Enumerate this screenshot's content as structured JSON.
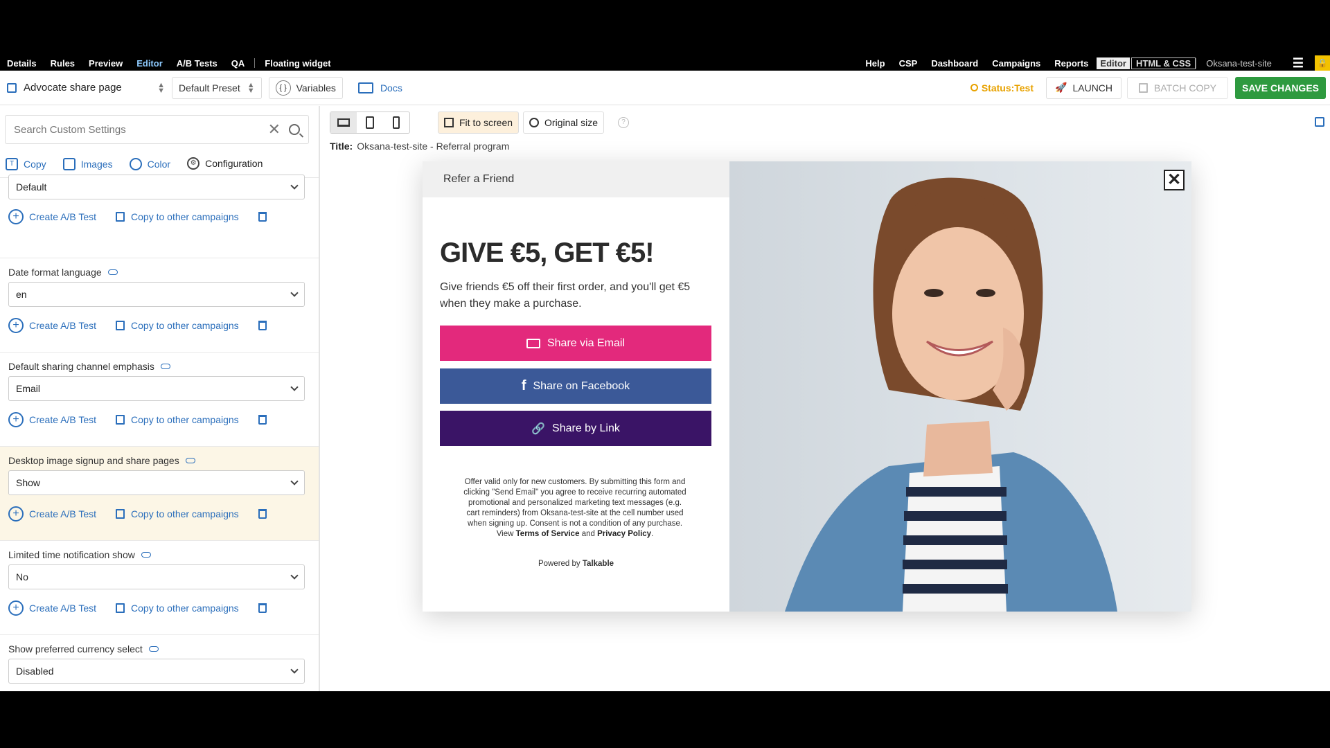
{
  "topnav": {
    "left": [
      "Details",
      "Rules",
      "Preview",
      "Editor",
      "A/B Tests",
      "QA"
    ],
    "active": "Editor",
    "widget": "Floating widget",
    "right": [
      "Help",
      "CSP",
      "Dashboard",
      "Campaigns",
      "Reports"
    ],
    "editor_pill": "Editor",
    "html_css": "HTML & CSS",
    "site": "Oksana-test-site"
  },
  "toolbar": {
    "page": "Advocate share page",
    "preset": "Default Preset",
    "variables": "Variables",
    "docs": "Docs",
    "status": "Status:Test",
    "launch": "LAUNCH",
    "batch_copy": "BATCH COPY",
    "save": "SAVE CHANGES"
  },
  "left": {
    "search_placeholder": "Search Custom Settings",
    "tabs": [
      "Copy",
      "Images",
      "Color",
      "Configuration"
    ],
    "active_tab": "Configuration",
    "create_ab": "Create A/B Test",
    "copy_other": "Copy to other campaigns",
    "first_value": "Default",
    "settings": [
      {
        "label": "Date format language",
        "value": "en"
      },
      {
        "label": "Default sharing channel emphasis",
        "value": "Email"
      },
      {
        "label": "Desktop image signup and share pages",
        "value": "Show"
      },
      {
        "label": "Limited time notification show",
        "value": "No"
      },
      {
        "label": "Show preferred currency select",
        "value": "Disabled"
      }
    ]
  },
  "canvas": {
    "fit": "Fit to screen",
    "original": "Original size",
    "title_label": "Title:",
    "title_value": "Oksana-test-site - Referral program"
  },
  "modal": {
    "header": "Refer a Friend",
    "headline": "GIVE €5, GET €5!",
    "subtext": "Give friends €5 off their first order, and you'll get €5 when they make a purchase.",
    "share_email": "Share via Email",
    "share_facebook": "Share on Facebook",
    "share_link": "Share by Link",
    "legal": "Offer valid only for new customers. By submitting this form and clicking \"Send Email\" you agree to receive recurring automated promotional and personalized marketing text messages (e.g. cart reminders) from Oksana-test-site at the cell number used when signing up. Consent is not a condition of any purchase.",
    "legal_view": "View",
    "terms": "Terms of Service",
    "and": "and",
    "privacy": "Privacy Policy",
    "powered_by": "Powered by",
    "brand": "Talkable"
  },
  "colors": {
    "email_btn": "#e3297c",
    "facebook_btn": "#3b5998",
    "link_btn": "#3a1466",
    "save_btn": "#2e9a3f",
    "status": "#e8a200",
    "link": "#2a6ebb"
  }
}
